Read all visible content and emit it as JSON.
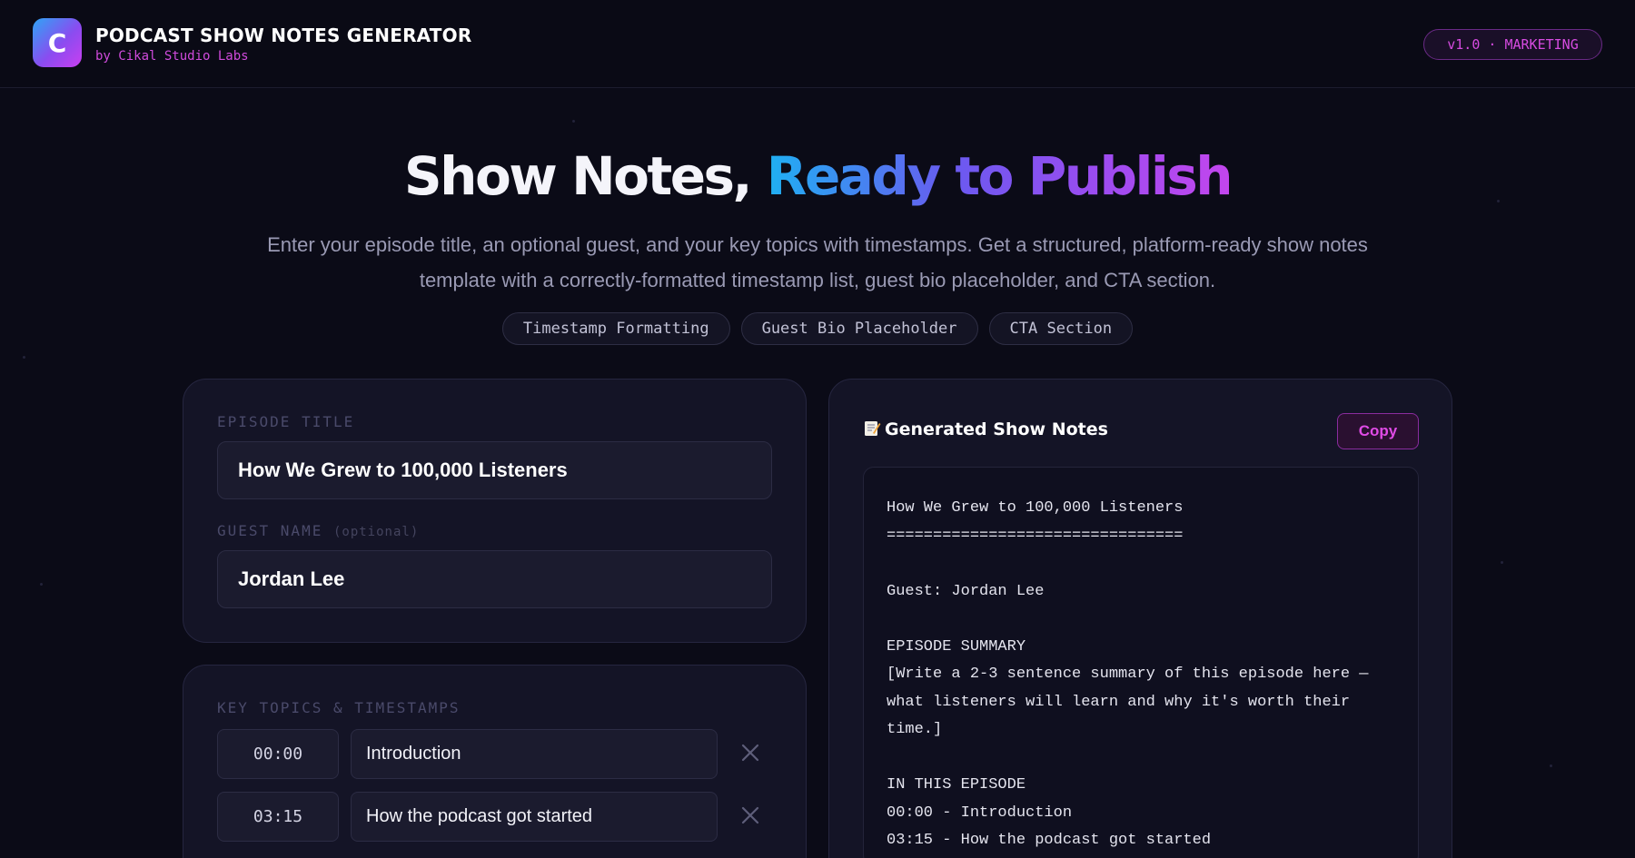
{
  "header": {
    "logo_letter": "C",
    "title": "PODCAST SHOW NOTES GENERATOR",
    "subtitle": "by Cikal Studio Labs",
    "version_badge": "v1.0 · MARKETING"
  },
  "hero": {
    "title_plain": "Show Notes, ",
    "title_gradient": "Ready to Publish",
    "description": "Enter your episode title, an optional guest, and your key topics with timestamps. Get a structured, platform-ready show notes template with a correctly-formatted timestamp list, guest bio placeholder, and CTA section.",
    "tags": [
      "Timestamp Formatting",
      "Guest Bio Placeholder",
      "CTA Section"
    ]
  },
  "form": {
    "episode_title_label": "EPISODE TITLE",
    "episode_title_value": "How We Grew to 100,000 Listeners",
    "guest_label": "GUEST NAME",
    "guest_optional": "(optional)",
    "guest_value": "Jordan Lee",
    "topics_label": "KEY TOPICS & TIMESTAMPS",
    "topics": [
      {
        "time": "00:00",
        "topic": "Introduction"
      },
      {
        "time": "03:15",
        "topic": "How the podcast got started"
      }
    ]
  },
  "output": {
    "icon": "memo-icon",
    "title": "Generated Show Notes",
    "copy_label": "Copy",
    "text": "How We Grew to 100,000 Listeners\n================================\n\nGuest: Jordan Lee\n\nEPISODE SUMMARY\n[Write a 2-3 sentence summary of this episode here — what listeners will learn and why it's worth their time.]\n\nIN THIS EPISODE\n00:00 - Introduction\n03:15 - How the podcast got started"
  },
  "colors": {
    "background": "#0b0b17",
    "accent_magenta": "#d64be0",
    "gradient_start": "#1fb0f2",
    "gradient_end": "#c346ee"
  }
}
